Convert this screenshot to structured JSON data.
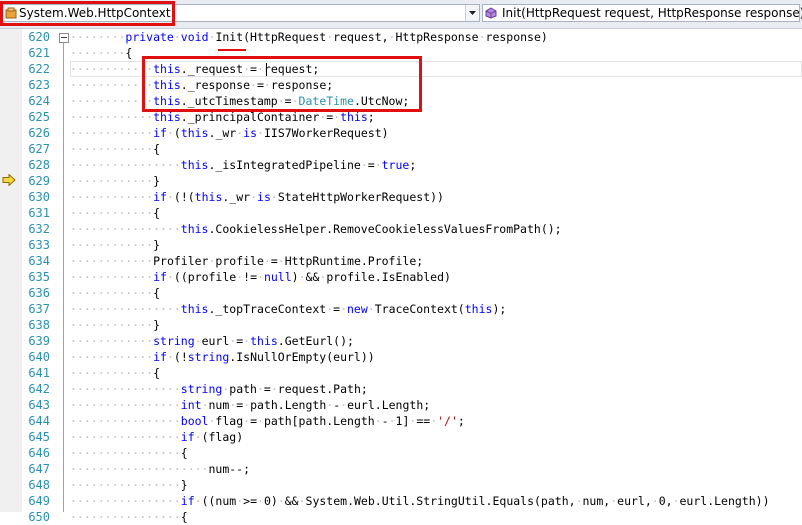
{
  "navigation": {
    "type_combo": {
      "label": "System.Web.HttpContext",
      "icon": "class-icon"
    },
    "member_combo": {
      "label": "Init(HttpRequest request, HttpResponse response)",
      "icon": "method-icon"
    }
  },
  "editor": {
    "current_statement_line": "629",
    "lines": [
      {
        "num": "620",
        "indent": 2,
        "tokens": [
          [
            "kw",
            "private"
          ],
          [
            "",
            "·"
          ],
          [
            "kw",
            "void"
          ],
          [
            "",
            "·Init(HttpRequest·request,·HttpResponse·response)"
          ]
        ]
      },
      {
        "num": "621",
        "indent": 2,
        "tokens": [
          [
            "",
            "{"
          ]
        ]
      },
      {
        "num": "622",
        "indent": 3,
        "tokens": [
          [
            "kw",
            "this"
          ],
          [
            "",
            "._request·=·request;"
          ]
        ]
      },
      {
        "num": "623",
        "indent": 3,
        "tokens": [
          [
            "kw",
            "this"
          ],
          [
            "",
            "._response·=·response;"
          ]
        ]
      },
      {
        "num": "624",
        "indent": 3,
        "tokens": [
          [
            "kw",
            "this"
          ],
          [
            "",
            "._utcTimestamp·=·"
          ],
          [
            "ty",
            "DateTime"
          ],
          [
            "",
            ".UtcNow;"
          ]
        ]
      },
      {
        "num": "625",
        "indent": 3,
        "tokens": [
          [
            "kw",
            "this"
          ],
          [
            "",
            "._principalContainer·=·"
          ],
          [
            "kw",
            "this"
          ],
          [
            "",
            ";"
          ]
        ]
      },
      {
        "num": "626",
        "indent": 3,
        "tokens": [
          [
            "kw",
            "if"
          ],
          [
            "",
            "·("
          ],
          [
            "kw",
            "this"
          ],
          [
            "",
            "._wr·"
          ],
          [
            "kw",
            "is"
          ],
          [
            "",
            "·IIS7WorkerRequest)"
          ]
        ]
      },
      {
        "num": "627",
        "indent": 3,
        "tokens": [
          [
            "",
            "{"
          ]
        ]
      },
      {
        "num": "628",
        "indent": 4,
        "tokens": [
          [
            "kw",
            "this"
          ],
          [
            "",
            "._isIntegratedPipeline·=·"
          ],
          [
            "kw",
            "true"
          ],
          [
            "",
            ";"
          ]
        ]
      },
      {
        "num": "629",
        "indent": 3,
        "tokens": [
          [
            "",
            "}"
          ]
        ]
      },
      {
        "num": "630",
        "indent": 3,
        "tokens": [
          [
            "kw",
            "if"
          ],
          [
            "",
            "·(!("
          ],
          [
            "kw",
            "this"
          ],
          [
            "",
            "._wr·"
          ],
          [
            "kw",
            "is"
          ],
          [
            "",
            "·StateHttpWorkerRequest))"
          ]
        ]
      },
      {
        "num": "631",
        "indent": 3,
        "tokens": [
          [
            "",
            "{"
          ]
        ]
      },
      {
        "num": "632",
        "indent": 4,
        "tokens": [
          [
            "kw",
            "this"
          ],
          [
            "",
            ".CookielessHelper.RemoveCookielessValuesFromPath();"
          ]
        ]
      },
      {
        "num": "633",
        "indent": 3,
        "tokens": [
          [
            "",
            "}"
          ]
        ]
      },
      {
        "num": "634",
        "indent": 3,
        "tokens": [
          [
            "",
            "Profiler·profile·=·HttpRuntime.Profile;"
          ]
        ]
      },
      {
        "num": "635",
        "indent": 3,
        "tokens": [
          [
            "kw",
            "if"
          ],
          [
            "",
            "·((profile·!=·"
          ],
          [
            "kw",
            "null"
          ],
          [
            "",
            ")·&&·profile.IsEnabled)"
          ]
        ]
      },
      {
        "num": "636",
        "indent": 3,
        "tokens": [
          [
            "",
            "{"
          ]
        ]
      },
      {
        "num": "637",
        "indent": 4,
        "tokens": [
          [
            "kw",
            "this"
          ],
          [
            "",
            "._topTraceContext·=·"
          ],
          [
            "kw",
            "new"
          ],
          [
            "",
            "·TraceContext("
          ],
          [
            "kw",
            "this"
          ],
          [
            "",
            ");"
          ]
        ]
      },
      {
        "num": "638",
        "indent": 3,
        "tokens": [
          [
            "",
            "}"
          ]
        ]
      },
      {
        "num": "639",
        "indent": 3,
        "tokens": [
          [
            "kw",
            "string"
          ],
          [
            "",
            "·eurl·=·"
          ],
          [
            "kw",
            "this"
          ],
          [
            "",
            ".GetEurl();"
          ]
        ]
      },
      {
        "num": "640",
        "indent": 3,
        "tokens": [
          [
            "kw",
            "if"
          ],
          [
            "",
            "·(!"
          ],
          [
            "kw",
            "string"
          ],
          [
            "",
            ".IsNullOrEmpty(eurl))"
          ]
        ]
      },
      {
        "num": "641",
        "indent": 3,
        "tokens": [
          [
            "",
            "{"
          ]
        ]
      },
      {
        "num": "642",
        "indent": 4,
        "tokens": [
          [
            "kw",
            "string"
          ],
          [
            "",
            "·path·=·request.Path;"
          ]
        ]
      },
      {
        "num": "643",
        "indent": 4,
        "tokens": [
          [
            "kw",
            "int"
          ],
          [
            "",
            "·num·=·path.Length·-·eurl.Length;"
          ]
        ]
      },
      {
        "num": "644",
        "indent": 4,
        "tokens": [
          [
            "kw",
            "bool"
          ],
          [
            "",
            "·flag·=·path[path.Length·-·1]·==·"
          ],
          [
            "st",
            "'/'"
          ],
          [
            "",
            ";"
          ]
        ]
      },
      {
        "num": "645",
        "indent": 4,
        "tokens": [
          [
            "kw",
            "if"
          ],
          [
            "",
            "·(flag)"
          ]
        ]
      },
      {
        "num": "646",
        "indent": 4,
        "tokens": [
          [
            "",
            "{"
          ]
        ]
      },
      {
        "num": "647",
        "indent": 5,
        "tokens": [
          [
            "",
            "num--;"
          ]
        ]
      },
      {
        "num": "648",
        "indent": 4,
        "tokens": [
          [
            "",
            "}"
          ]
        ]
      },
      {
        "num": "649",
        "indent": 4,
        "tokens": [
          [
            "kw",
            "if"
          ],
          [
            "",
            "·((num·>=·0)·&&·System.Web.Util.StringUtil.Equals(path,·num,·eurl,·0,·eurl.Length))"
          ]
        ]
      },
      {
        "num": "650",
        "indent": 4,
        "tokens": [
          [
            "",
            "{"
          ]
        ]
      }
    ]
  },
  "colors": {
    "keyword": "#0000ff",
    "type": "#2b91af",
    "string": "#a31515",
    "annotation": "#e01010"
  }
}
